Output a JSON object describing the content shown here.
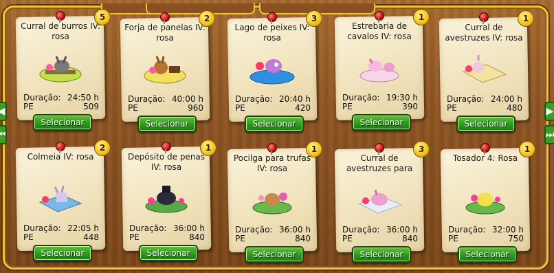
{
  "select_label": "Selecionar",
  "duration_label": "Duração:",
  "pe_label": "PE",
  "cards": [
    {
      "title": "Curral de burros IV: rosa",
      "count": "5",
      "duration": "24:50 h",
      "pe": "509"
    },
    {
      "title": "Forja de panelas IV: rosa",
      "count": "2",
      "duration": "40:00 h",
      "pe": "960"
    },
    {
      "title": "Lago de peixes IV: rosa",
      "count": "3",
      "duration": "20:40 h",
      "pe": "420"
    },
    {
      "title": "Estrebaria de cavalos IV: rosa",
      "count": "1",
      "duration": "19:30 h",
      "pe": "390"
    },
    {
      "title": "Curral de avestruzes IV: rosa",
      "count": "1",
      "duration": "24:00 h",
      "pe": "480"
    },
    {
      "title": "Colmeia IV: rosa",
      "count": "2",
      "duration": "22:05 h",
      "pe": "448"
    },
    {
      "title": "Depósito de penas IV: rosa",
      "count": "1",
      "duration": "36:00 h",
      "pe": "840"
    },
    {
      "title": "Pocilga para trufas IV: rosa",
      "count": "1",
      "duration": "36:00 h",
      "pe": "840"
    },
    {
      "title": "Curral de avestruzes para",
      "count": "3",
      "duration": "36:00 h",
      "pe": "840"
    },
    {
      "title": "Tosador 4: Rosa",
      "count": "1",
      "duration": "32:00 h",
      "pe": "750"
    }
  ],
  "icons": {
    "pin": "pushpin-icon",
    "nav_left": "arrow-left-icon",
    "nav_right": "arrow-right-icon",
    "nav_last": "skip-right-icon"
  },
  "colors": {
    "button": "#2f9a1c",
    "badge": "#f2c21a",
    "frame": "#f0c43a"
  }
}
